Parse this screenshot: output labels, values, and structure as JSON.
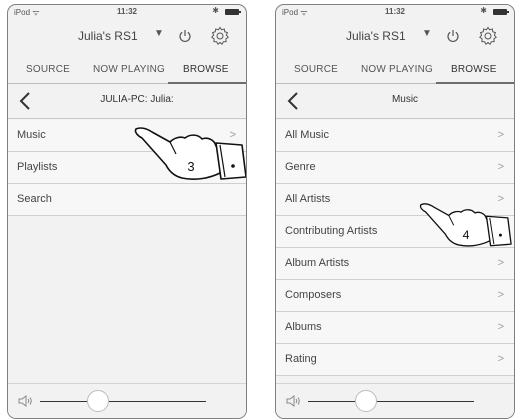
{
  "screens": [
    {
      "status_bar": {
        "carrier": "iPod ᯤ",
        "time": "11:32",
        "bluetooth": "✱"
      },
      "device": {
        "name": "Julia's RS1",
        "dropdown": "▼"
      },
      "tabs": [
        {
          "label": "SOURCE",
          "active": false
        },
        {
          "label": "NOW PLAYING",
          "active": false
        },
        {
          "label": "BROWSE",
          "active": true
        }
      ],
      "nav_title": "JULIA-PC: Julia:",
      "items": [
        {
          "label": "Music",
          "chevron": ">"
        },
        {
          "label": "Playlists",
          "chevron": ">"
        },
        {
          "label": "Search",
          "chevron": ""
        }
      ],
      "step_number": "3",
      "volume_level": 0.35,
      "icons": [
        "power-icon",
        "gear-icon",
        "back-icon",
        "speaker-icon",
        "pointing-hand-icon"
      ]
    },
    {
      "status_bar": {
        "carrier": "iPod ᯤ",
        "time": "11:32",
        "bluetooth": "✱"
      },
      "device": {
        "name": "Julia's RS1",
        "dropdown": "▼"
      },
      "tabs": [
        {
          "label": "SOURCE",
          "active": false
        },
        {
          "label": "NOW PLAYING",
          "active": false
        },
        {
          "label": "BROWSE",
          "active": true
        }
      ],
      "nav_title": "Music",
      "items": [
        {
          "label": "All Music",
          "chevron": ">"
        },
        {
          "label": "Genre",
          "chevron": ">"
        },
        {
          "label": "All Artists",
          "chevron": ">"
        },
        {
          "label": "Contributing Artists",
          "chevron": ">"
        },
        {
          "label": "Album Artists",
          "chevron": ">"
        },
        {
          "label": "Composers",
          "chevron": ">"
        },
        {
          "label": "Albums",
          "chevron": ">"
        },
        {
          "label": "Rating",
          "chevron": ">"
        }
      ],
      "step_number": "4",
      "volume_level": 0.35,
      "icons": [
        "power-icon",
        "gear-icon",
        "back-icon",
        "speaker-icon",
        "pointing-hand-icon"
      ]
    }
  ]
}
